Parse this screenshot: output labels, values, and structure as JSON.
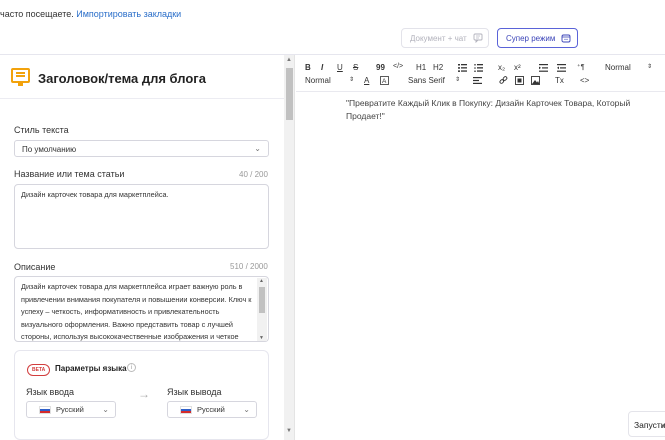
{
  "bookmarks": {
    "prefix": "часто посещаете.",
    "import_link": "Импортировать закладки"
  },
  "topbar": {
    "doc_chat_label": "Документ + чат",
    "super_mode_label": "Супер режим"
  },
  "panel": {
    "title": "Заголовок/тема для блога",
    "style_label": "Стиль текста",
    "style_value": "По умолчанию",
    "title_field_label": "Название или тема статьи",
    "title_counter": "40 / 200",
    "title_value": "Дизайн карточек товара для маркетплейса.",
    "desc_label": "Описание",
    "desc_counter": "510 / 2000",
    "desc_value": "Дизайн карточек товара для маркетплейса играет важную роль в привлечении внимания покупателя и повышении конверсии. Ключ к успеху – четкость, информативность и привлекательность визуального оформления. Важно представить товар с лучшей стороны, используя высококачественные изображения и четкое",
    "lang": {
      "badge": "BETA",
      "title": "Параметры языка",
      "input_label": "Язык ввода",
      "output_label": "Язык вывода",
      "input_value": "Русский",
      "output_value": "Русский"
    }
  },
  "toolbar": {
    "bold": "B",
    "italic": "I",
    "underline": "U",
    "strike": "S",
    "quote": "99",
    "code": "</>",
    "h1": "H1",
    "h2": "H2",
    "sub": "x₂",
    "sup": "x²",
    "ltr": "⁺¶",
    "size_select": "Normal",
    "heading_select": "Normal",
    "font_color": "A",
    "font_select": "Sans Serif",
    "clear": "Tx",
    "html": "<>"
  },
  "editor": {
    "content": "\"Превратите Каждый Клик в Покупку: Дизайн Карточек Товара, Который Продает!\""
  },
  "run_button": "Запусти"
}
